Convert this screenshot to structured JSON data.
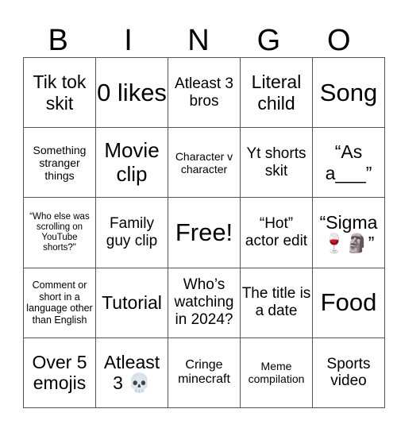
{
  "header": {
    "letters": [
      "B",
      "I",
      "N",
      "G",
      "O"
    ]
  },
  "board": {
    "rows": [
      [
        "Tik tok skit",
        "0 likes",
        "Atleast 3 bros",
        "Literal child",
        "Song"
      ],
      [
        "Something stranger things",
        "Movie clip",
        "Character v character",
        "Yt shorts skit",
        "“As a___”"
      ],
      [
        "“Who else was scrolling on YouTube shorts?\"",
        "Family guy clip",
        "Free!",
        "“Hot” actor edit",
        "“Sigma 🍷🗿”"
      ],
      [
        "Comment or short in a language other than English",
        "Tutorial",
        "Who’s watching in 2024?",
        "The title is a date",
        "Food"
      ],
      [
        "Over 5 emojis",
        "Atleast 3 💀",
        "Cringe minecraft",
        "Meme compilation",
        "Sports video"
      ]
    ],
    "free_space": {
      "row": 2,
      "col": 2
    }
  }
}
